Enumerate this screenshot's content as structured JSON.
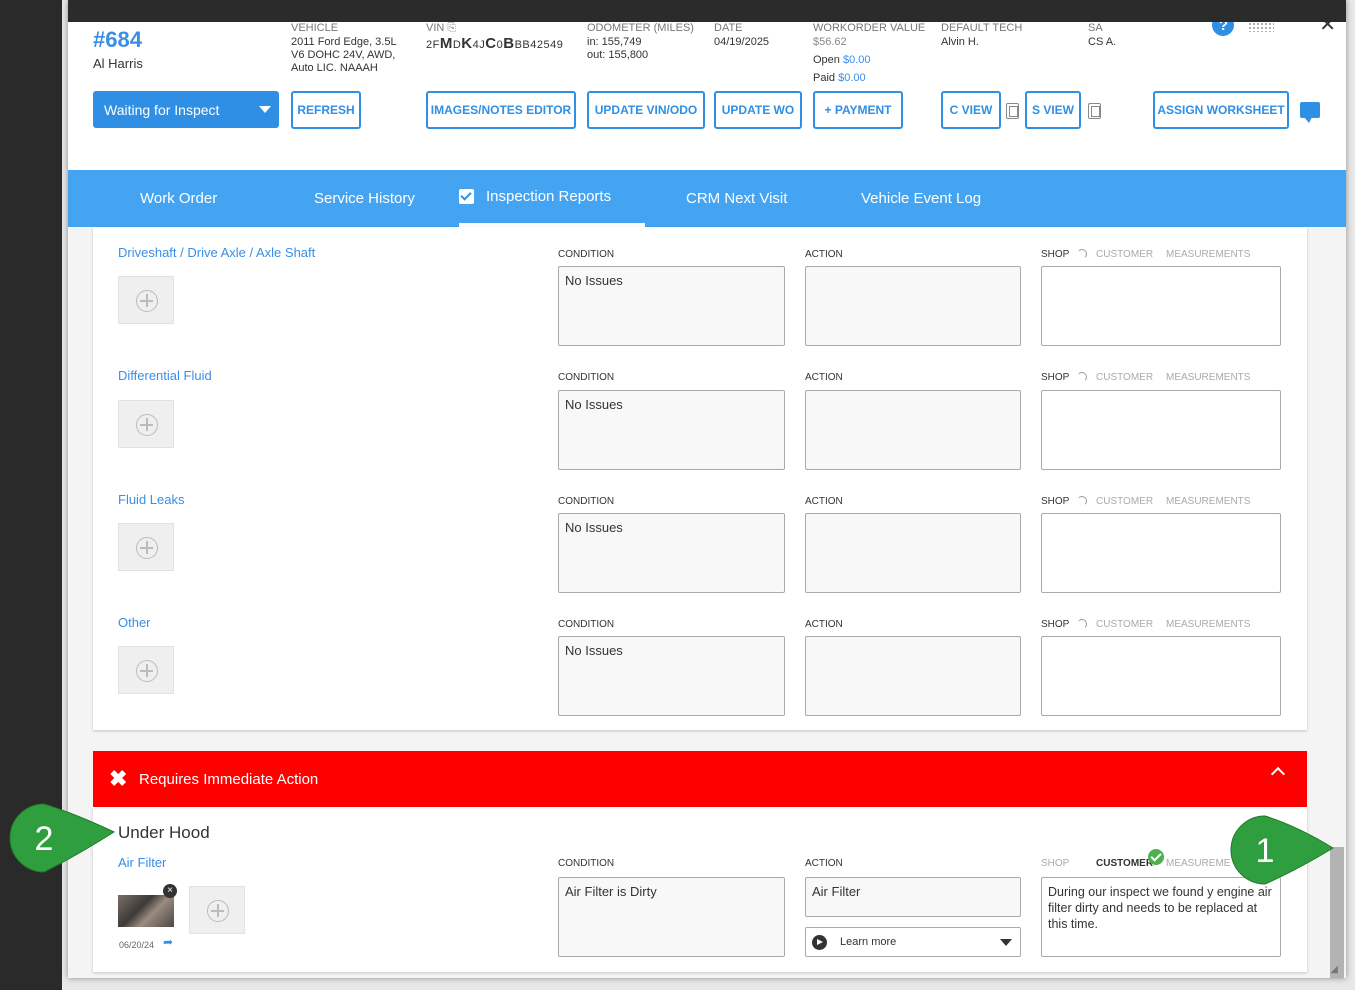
{
  "header": {
    "wo_number": "#684",
    "customer": "Al Harris",
    "vehicle_label": "VEHICLE",
    "vehicle_line1": "2011 Ford Edge, 3.5L",
    "vehicle_line2": "V6 DOHC 24V, AWD,",
    "vehicle_line3": "Auto LIC. NAAAH",
    "vin_label": "VIN",
    "vin_parts": [
      "2F",
      "M",
      "D",
      "K",
      "4J",
      "C",
      "0",
      "B",
      "BB42549"
    ],
    "odometer_label": "ODOMETER (MILES)",
    "odometer_in": "in: 155,749",
    "odometer_out": "out: 155,800",
    "date_label": "DATE",
    "date_value": "04/19/2025",
    "wo_value_label": "WORKORDER VALUE",
    "wo_value": "$56.62",
    "open_label": "Open",
    "open_value": "$0.00",
    "paid_label": "Paid",
    "paid_value": "$0.00",
    "tech_label": "DEFAULT TECH",
    "tech_value": "Alvin H.",
    "sa_label": "SA",
    "sa_value": "CS A.",
    "help_glyph": "?",
    "collapse_glyph": "⌃",
    "close_glyph": "✕"
  },
  "toolbar": {
    "status": "Waiting for Inspect",
    "refresh": "REFRESH",
    "images_notes": "IMAGES/NOTES EDITOR",
    "update_vin": "UPDATE VIN/ODO",
    "update_wo": "UPDATE WO",
    "payment": "+ PAYMENT",
    "c_view": "C VIEW",
    "s_view": "S VIEW",
    "assign_worksheet": "ASSIGN WORKSHEET"
  },
  "tabs": [
    "Work Order",
    "Service History",
    "Inspection Reports",
    "CRM Next Visit",
    "Vehicle Event Log"
  ],
  "columns": {
    "condition": "CONDITION",
    "action": "ACTION",
    "shop": "SHOP",
    "customer": "CUSTOMER",
    "measurements": "MEASUREMENTS",
    "measurements_cut": "MEASUREME"
  },
  "items": [
    {
      "title": "Driveshaft / Drive Axle / Axle Shaft",
      "condition": "No Issues",
      "action": ""
    },
    {
      "title": "Differential Fluid",
      "condition": "No Issues",
      "action": ""
    },
    {
      "title": "Fluid Leaks",
      "condition": "No Issues",
      "action": ""
    },
    {
      "title": "Other",
      "condition": "No Issues",
      "action": ""
    }
  ],
  "alert": {
    "title": "Requires Immediate Action",
    "icon": "✖"
  },
  "urgent_section": {
    "heading": "Under Hood",
    "item_title": "Air Filter",
    "photo_date": "06/20/24",
    "condition": "Air Filter is Dirty",
    "action": "Air Filter",
    "learn_more": "Learn more",
    "customer_note": "During our inspect we found y engine air filter dirty and needs to be replaced at this time."
  },
  "callouts": [
    "1",
    "2"
  ],
  "colors": {
    "accent": "#2f8fe5",
    "tab_bar": "#44a4f2",
    "alert": "#ff0000",
    "callout": "#2e9e3e"
  }
}
